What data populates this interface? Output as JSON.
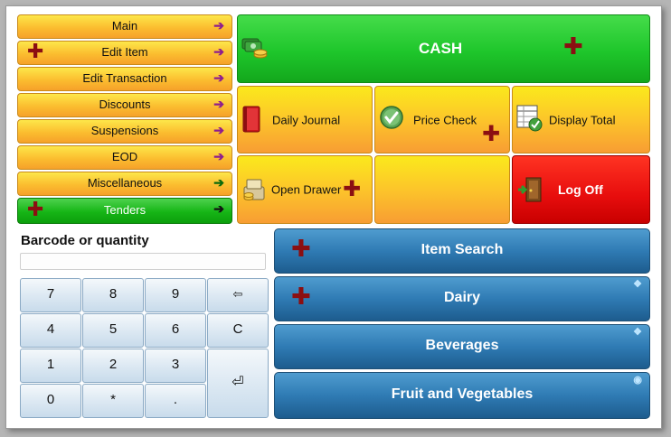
{
  "menu": {
    "items": [
      {
        "label": "Main",
        "arrow": "➔"
      },
      {
        "label": "Edit Item",
        "arrow": "➔"
      },
      {
        "label": "Edit Transaction",
        "arrow": "➔"
      },
      {
        "label": "Discounts",
        "arrow": "➔"
      },
      {
        "label": "Suspensions",
        "arrow": "➔"
      },
      {
        "label": "EOD",
        "arrow": "➔"
      },
      {
        "label": "Miscellaneous",
        "arrow": "➔"
      },
      {
        "label": "Tenders",
        "arrow": "➔"
      }
    ]
  },
  "tiles": {
    "cash": "CASH",
    "daily_journal": "Daily Journal",
    "price_check": "Price Check",
    "display_total": "Display Total",
    "open_drawer": "Open Drawer",
    "log_off": "Log Off"
  },
  "entry": {
    "label": "Barcode or quantity",
    "value": ""
  },
  "keypad": {
    "k7": "7",
    "k8": "8",
    "k9": "9",
    "back": "⇦",
    "k4": "4",
    "k5": "5",
    "k6": "6",
    "clear": "C",
    "k1": "1",
    "k2": "2",
    "k3": "3",
    "enter": "⏎",
    "k0": "0",
    "star": "*",
    "dot": "."
  },
  "bars": {
    "item_search": "Item Search",
    "dairy": "Dairy",
    "beverages": "Beverages",
    "fruit_veg": "Fruit and Vegetables"
  },
  "icons": {
    "plus": "✚",
    "arrow": "➔",
    "expand": "❖",
    "radio": "◉"
  },
  "colors": {
    "accent_green": "#1ec62b",
    "accent_red": "#e70d0d",
    "accent_blue": "#2f7bb4",
    "plus_color": "#8b0f12"
  }
}
